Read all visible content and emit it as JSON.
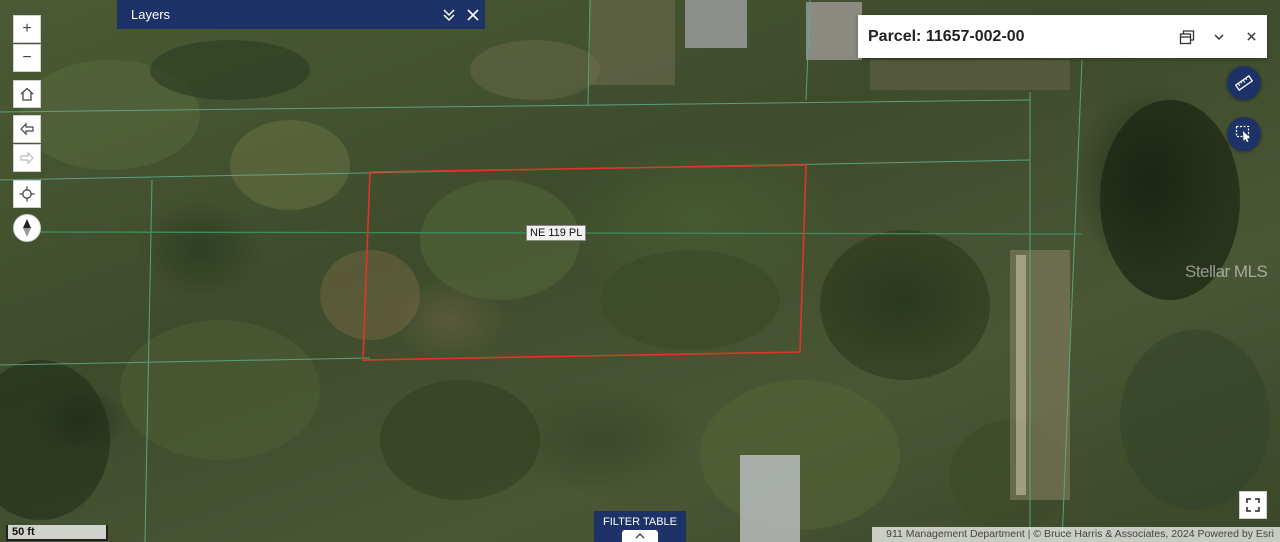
{
  "layers_panel": {
    "title": "Layers"
  },
  "zoom": {
    "in": "+",
    "out": "−"
  },
  "popup": {
    "title": "Parcel: 11657-002-00"
  },
  "map": {
    "street_label": "NE 119 PL",
    "watermark": "Stellar MLS",
    "parcel_outline_color": "#e0342a",
    "parcel_line_color": "#3a8f5f"
  },
  "filter_table": {
    "label": "FILTER TABLE"
  },
  "scale": {
    "label": "50 ft"
  },
  "attribution": {
    "text": "911 Management Department | © Bruce Harris & Associates, 2024   Powered by Esri"
  },
  "colors": {
    "accent": "#1d3266"
  }
}
